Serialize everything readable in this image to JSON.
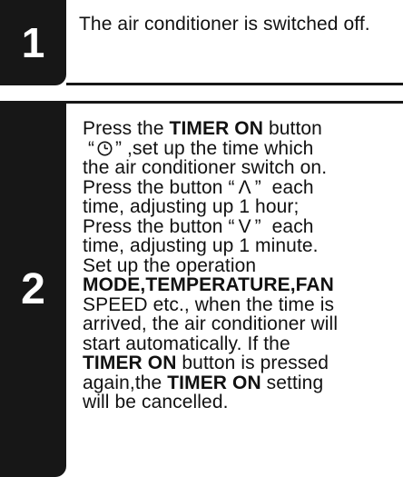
{
  "step1": {
    "number": "1",
    "text": "The air conditioner is switched off."
  },
  "step2": {
    "number": "2",
    "l1_a": "Press the ",
    "l1_b": "TIMER ON",
    "l1_c": " button",
    "l2_q1": "“",
    "l2_q2": "”",
    "l2_rest": " ,set up the time which",
    "l3": "the air conditioner switch on.",
    "l4_a": "Press the button",
    "l4_q1": "“",
    "l4_arrow": "Λ",
    "l4_q2": "”",
    "l4_b": "each",
    "l5": "time, adjusting up 1 hour;",
    "l6_a": "Press the button",
    "l6_q1": "“",
    "l6_arrow": "V",
    "l6_q2": "”",
    "l6_b": "each",
    "l7": "time, adjusting up 1 minute.",
    "l8": "Set up the operation",
    "l9": "MODE,TEMPERATURE,FAN",
    "l10": "SPEED etc., when the time is",
    "l11": "arrived, the air conditioner will",
    "l12": "start automatically. If the",
    "l13_a": "TIMER ON",
    "l13_b": " button is pressed",
    "l14_a": "again,the ",
    "l14_b": "TIMER ON",
    "l14_c": " setting",
    "l15": "will be cancelled."
  }
}
